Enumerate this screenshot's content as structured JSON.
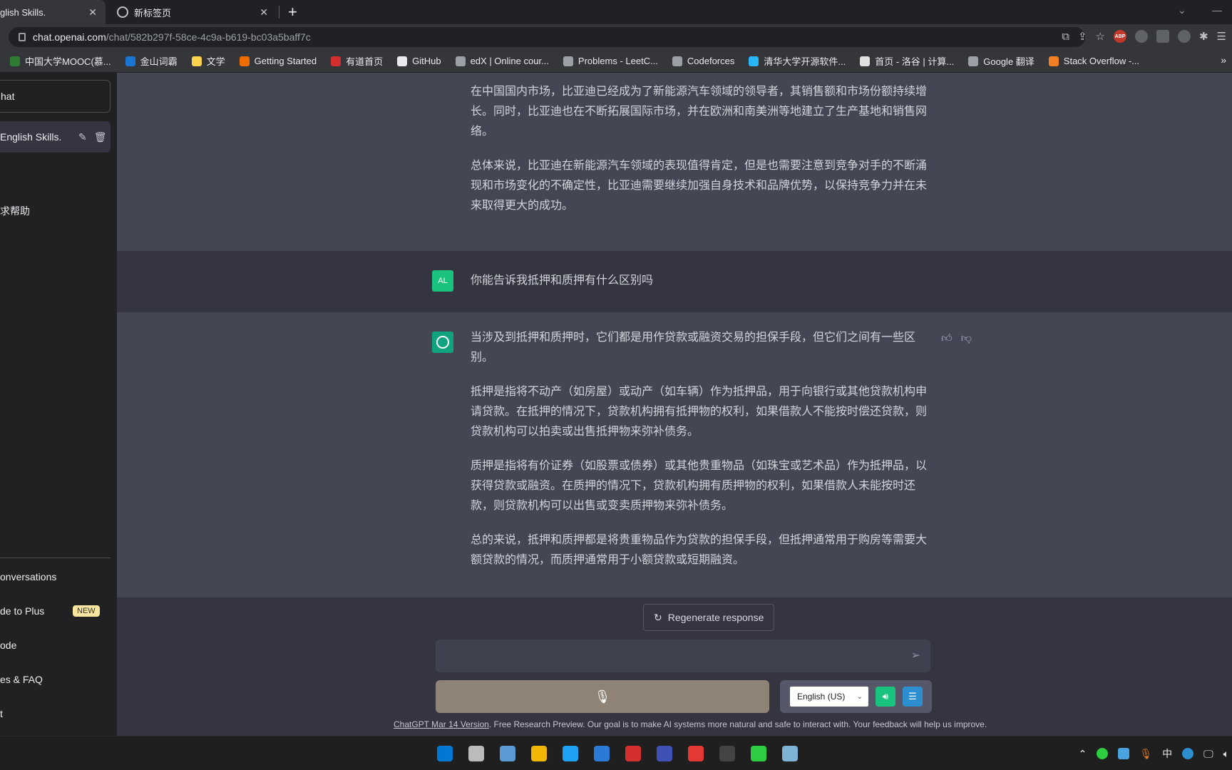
{
  "browser": {
    "tabs": [
      {
        "title": "glish Skills.",
        "active": true
      },
      {
        "title": "新标签页",
        "active": false
      }
    ],
    "new_tab_label": "+",
    "url_host": "chat.openai.com",
    "url_path": "/chat/582b297f-58ce-4c9a-b619-bc03a5baff7c",
    "bookmarks": [
      {
        "label": "中国大学MOOC(慕...",
        "color": "#2e7d32"
      },
      {
        "label": "金山词霸",
        "color": "#1976d2"
      },
      {
        "label": "文学",
        "color": "#f9d34c"
      },
      {
        "label": "Getting Started",
        "color": "#ef6c00"
      },
      {
        "label": "有道首页",
        "color": "#d32f2f"
      },
      {
        "label": "GitHub",
        "color": "#e8eaed"
      },
      {
        "label": "edX | Online cour...",
        "color": "#9aa0a6"
      },
      {
        "label": "Problems - LeetC...",
        "color": "#9aa0a6"
      },
      {
        "label": "Codeforces",
        "color": "#9aa0a6"
      },
      {
        "label": "清华大学开源软件...",
        "color": "#29b6f6"
      },
      {
        "label": "首页 - 洛谷 | 计算...",
        "color": "#e0e0e0"
      },
      {
        "label": "Google 翻译",
        "color": "#9aa0a6"
      },
      {
        "label": "Stack Overflow -...",
        "color": "#f48024"
      }
    ],
    "toolbar_abp": "ABP"
  },
  "sidebar": {
    "new_chat": "hat",
    "active_conversation": "English Skills.",
    "conversation_2": "求帮助",
    "bottom_items": [
      {
        "label": "onversations"
      },
      {
        "label": "de to Plus",
        "badge": "NEW"
      },
      {
        "label": "ode"
      },
      {
        "label": "es & FAQ"
      },
      {
        "label": "t"
      }
    ]
  },
  "chat": {
    "prev_answer": [
      "在中国国内市场，比亚迪已经成为了新能源汽车领域的领导者，其销售额和市场份额持续增长。同时，比亚迪也在不断拓展国际市场，并在欧洲和南美洲等地建立了生产基地和销售网络。",
      "总体来说，比亚迪在新能源汽车领域的表现值得肯定，但是也需要注意到竞争对手的不断涌现和市场变化的不确定性，比亚迪需要继续加强自身技术和品牌优势，以保持竞争力并在未来取得更大的成功。"
    ],
    "user_avatar": "AL",
    "user_question": "你能告诉我抵押和质押有什么区别吗",
    "answer": [
      "当涉及到抵押和质押时，它们都是用作贷款或融资交易的担保手段，但它们之间有一些区别。",
      "抵押是指将不动产（如房屋）或动产（如车辆）作为抵押品，用于向银行或其他贷款机构申请贷款。在抵押的情况下，贷款机构拥有抵押物的权利，如果借款人不能按时偿还贷款，则贷款机构可以拍卖或出售抵押物来弥补债务。",
      "质押是指将有价证券（如股票或债券）或其他贵重物品（如珠宝或艺术品）作为抵押品，以获得贷款或融资。在质押的情况下，贷款机构拥有质押物的权利，如果借款人未能按时还款，则贷款机构可以出售或变卖质押物来弥补债务。",
      "总的来说，抵押和质押都是将贵重物品作为贷款的担保手段，但抵押通常用于购房等需要大额贷款的情况，而质押通常用于小额贷款或短期融资。"
    ],
    "regenerate_label": "Regenerate response",
    "input_placeholder": "",
    "language": "English (US)",
    "footer_link": "ChatGPT Mar 14 Version",
    "footer_text": ". Free Research Preview. Our goal is to make AI systems more natural and safe to interact with. Your feedback will help us improve."
  },
  "taskbar": {
    "apps": [
      "#0078d4",
      "#bbbbbb",
      "#5b9bd5",
      "#f2b705",
      "#1da1f2",
      "#2b7bd6",
      "#d32f2f",
      "#3f51b5",
      "#e53935",
      "#444444",
      "#2ecc40",
      "#7fb3d5"
    ],
    "ime": "中"
  },
  "colors": {
    "accent": "#10a37f",
    "main_bg": "#343541",
    "bot_bg": "#444654",
    "sidebar_bg": "#202123"
  }
}
